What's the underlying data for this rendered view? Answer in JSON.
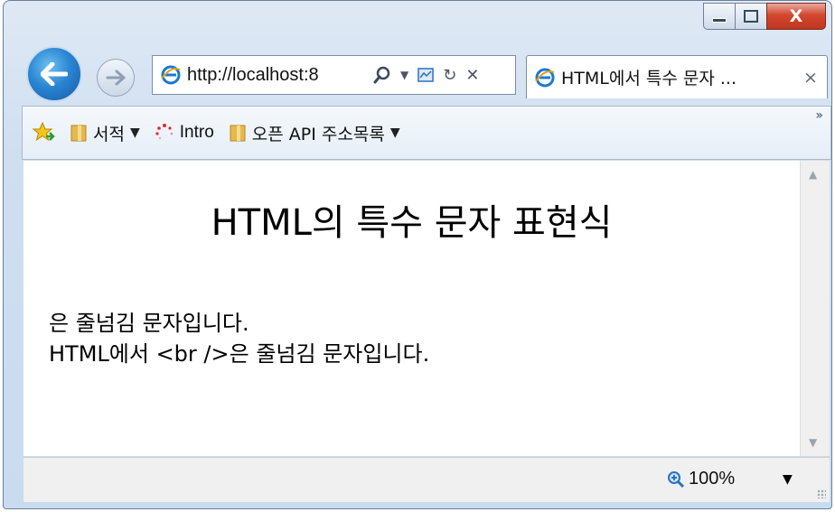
{
  "window": {
    "controls": {
      "minimize": "—",
      "maximize": "☐",
      "close": "X"
    }
  },
  "nav": {
    "address": "http://localhost:8",
    "tab_title": "HTML에서 특수 문자 ...",
    "tab_close": "×"
  },
  "favorites": {
    "items": [
      {
        "label": "서적",
        "has_dropdown": true,
        "icon": "folder-icon"
      },
      {
        "label": "Intro",
        "has_dropdown": false,
        "icon": "page-icon"
      },
      {
        "label": "오픈 API 주소목록",
        "has_dropdown": true,
        "icon": "folder-icon"
      }
    ],
    "more": "»"
  },
  "page": {
    "title": "HTML의 특수 문자 표현식",
    "line1": "은 줄넘김 문자입니다.",
    "line2": "HTML에서 <br />은 줄넘김 문자입니다."
  },
  "status": {
    "zoom": "100%"
  },
  "colors": {
    "accent": "#2a86d2",
    "close": "#c0361f"
  }
}
